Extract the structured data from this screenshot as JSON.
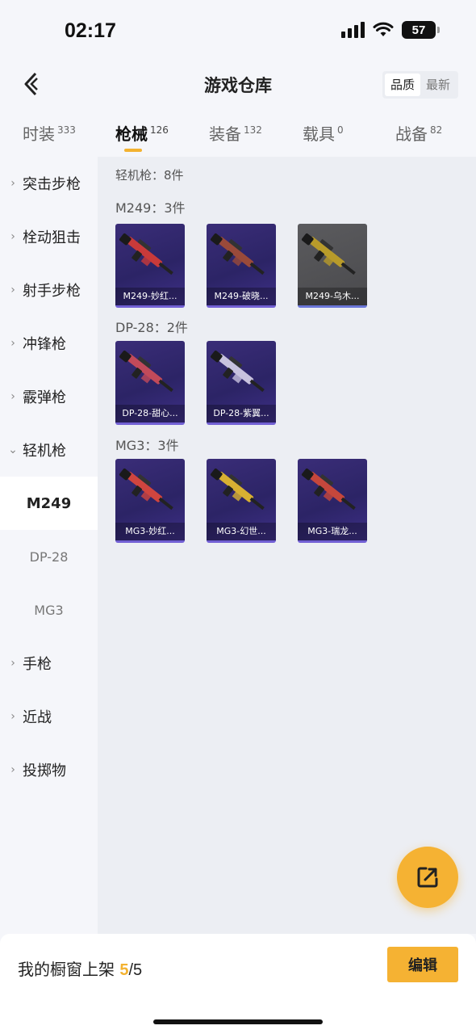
{
  "status_bar": {
    "time": "02:17",
    "battery": "57"
  },
  "header": {
    "title": "游戏仓库",
    "sort_options": [
      "品质",
      "最新"
    ],
    "sort_active": "品质"
  },
  "tabs": [
    {
      "label": "时装",
      "count": "333"
    },
    {
      "label": "枪械",
      "count": "126",
      "active": true
    },
    {
      "label": "装备",
      "count": "132"
    },
    {
      "label": "载具",
      "count": "0"
    },
    {
      "label": "战备",
      "count": "82"
    }
  ],
  "sidebar": {
    "categories": [
      {
        "label": "突击步枪"
      },
      {
        "label": "栓动狙击"
      },
      {
        "label": "射手步枪"
      },
      {
        "label": "冲锋枪"
      },
      {
        "label": "霰弹枪"
      },
      {
        "label": "轻机枪",
        "expanded": true
      }
    ],
    "subitems": [
      {
        "label": "M249",
        "active": true
      },
      {
        "label": "DP-28"
      },
      {
        "label": "MG3"
      }
    ],
    "categories_after": [
      {
        "label": "手枪"
      },
      {
        "label": "近战"
      },
      {
        "label": "投掷物"
      }
    ]
  },
  "content": {
    "total": "轻机枪：8件",
    "groups": [
      {
        "title": "M249：3件",
        "items": [
          {
            "label": "M249-妙红...",
            "accent": "#c93a3a",
            "style": "purple"
          },
          {
            "label": "M249-破晓...",
            "accent": "#9a4a3a",
            "style": "purple"
          },
          {
            "label": "M249-乌木...",
            "accent": "#b89b2a",
            "style": "gray"
          }
        ]
      },
      {
        "title": "DP-28：2件",
        "items": [
          {
            "label": "DP-28-甜心...",
            "accent": "#c24a5a",
            "style": "purple"
          },
          {
            "label": "DP-28-紫翼...",
            "accent": "#c8c2de",
            "style": "purple"
          }
        ]
      },
      {
        "title": "MG3：3件",
        "items": [
          {
            "label": "MG3-妙红...",
            "accent": "#d0453f",
            "style": "purple"
          },
          {
            "label": "MG3-幻世...",
            "accent": "#d8b032",
            "style": "purple"
          },
          {
            "label": "MG3-瑞龙...",
            "accent": "#c5473c",
            "style": "purple"
          }
        ]
      }
    ]
  },
  "bottom_bar": {
    "label": "我的橱窗上架",
    "count": "5",
    "total": "/5",
    "edit_label": "编辑"
  },
  "colors": {
    "accent": "#f5b233",
    "card_purple": "#2c2466"
  }
}
